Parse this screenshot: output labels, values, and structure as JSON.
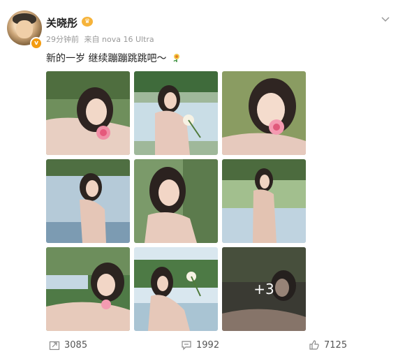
{
  "post": {
    "author": "关晓彤",
    "time": "29分钟前",
    "source": "来自 nova 16 Ultra",
    "text": "新的一岁 继续蹦蹦跳跳吧～",
    "more_photos": "+3",
    "photos": [
      {
        "scene": "pond-flower"
      },
      {
        "scene": "pond-hold"
      },
      {
        "scene": "closeup-flower"
      },
      {
        "scene": "lake-sky"
      },
      {
        "scene": "forest-portrait"
      },
      {
        "scene": "lake-stand"
      },
      {
        "scene": "lying-grass"
      },
      {
        "scene": "trees-flower"
      },
      {
        "scene": "dark-more"
      }
    ]
  },
  "actions": {
    "repost_count": "3085",
    "comment_count": "1992",
    "like_count": "7125"
  },
  "icons": {
    "vip_badge": "v-badge-icon",
    "crown": "crown-icon",
    "expand": "chevron-down-icon",
    "emoji": "flower-emoji-icon",
    "repost": "repost-icon",
    "comment": "comment-icon",
    "like": "thumbs-up-icon"
  },
  "colors": {
    "accent": "#f39c12",
    "text": "#222222",
    "meta": "#999999"
  }
}
